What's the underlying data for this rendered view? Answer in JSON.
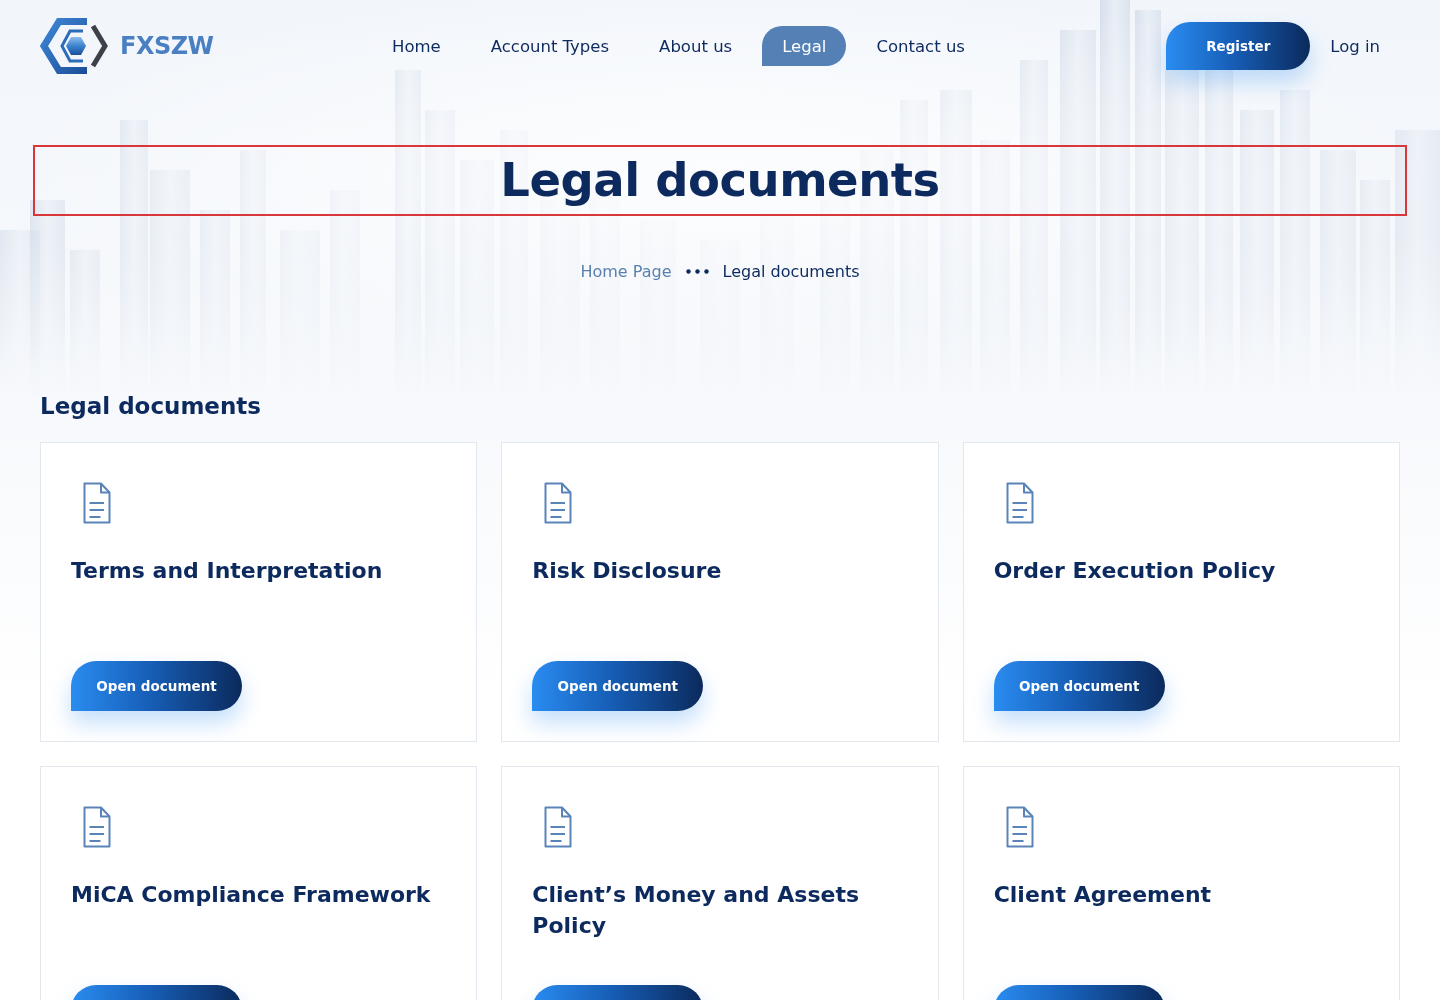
{
  "header": {
    "logo": "FXSZW",
    "nav": [
      {
        "label": "Home",
        "selected": false
      },
      {
        "label": "Account Types",
        "selected": false
      },
      {
        "label": "About us",
        "selected": false
      },
      {
        "label": "Legal",
        "selected": true
      },
      {
        "label": "Contact us",
        "selected": false
      }
    ],
    "register": "Register",
    "login": "Log in"
  },
  "hero": {
    "title": "Legal documents",
    "highlighted": true,
    "breadcrumb": [
      {
        "label": "Home Page",
        "current": false
      },
      {
        "label": "Legal documents",
        "current": true
      }
    ]
  },
  "documents": {
    "heading": "Legal documents",
    "cards": [
      {
        "title": "Terms and Interpretation",
        "button": "Open document"
      },
      {
        "title": "Risk Disclosure",
        "button": "Open document"
      },
      {
        "title": "Order Execution Policy",
        "button": "Open document"
      },
      {
        "title": "MiCA Compliance Framework"
      },
      {
        "title": "Client’s Money and Assets Policy"
      },
      {
        "title": "Client Agreement"
      }
    ]
  }
}
